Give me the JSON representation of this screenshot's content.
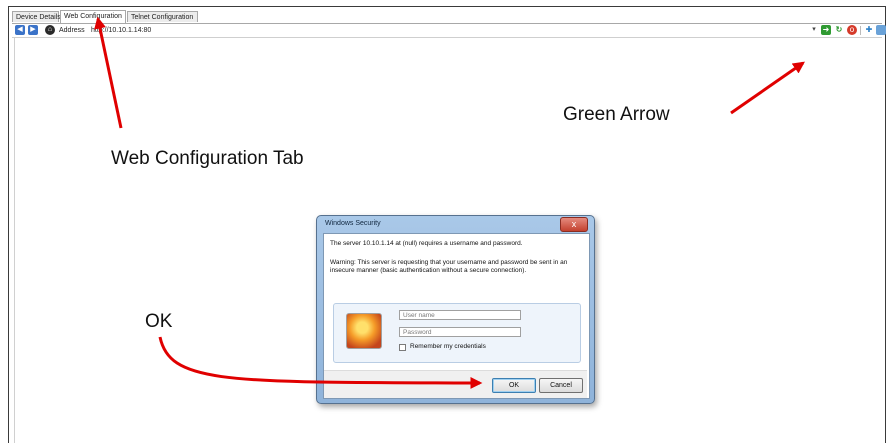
{
  "tabs": [
    {
      "label": "Device Details",
      "active": false
    },
    {
      "label": "Web Configuration",
      "active": true
    },
    {
      "label": "Telnet Configuration",
      "active": false
    }
  ],
  "toolbar": {
    "address_label": "Address",
    "address_value": "http://10.10.1.14:80",
    "icons": [
      "back-icon",
      "forward-icon",
      "home-icon",
      "dropdown-icon",
      "green-arrow-icon",
      "refresh-icon",
      "stop-icon",
      "favorites-icon",
      "screen-icon"
    ]
  },
  "annotations": {
    "web_config": "Web Configuration Tab",
    "green_arrow": "Green Arrow",
    "ok": "OK"
  },
  "dialog": {
    "title": "Windows Security",
    "close_glyph": "x",
    "message": "The server 10.10.1.14 at (null) requires a username and password.",
    "warning": "Warning: This server is requesting that your username and password be sent in an insecure manner (basic authentication without a secure connection).",
    "username_placeholder": "User name",
    "password_placeholder": "Password",
    "remember_label": "Remember my credentials",
    "ok_label": "OK",
    "cancel_label": "Cancel"
  },
  "colors": {
    "annotation_arrow": "#e00000",
    "nav_blue": "#3b73c8",
    "dialog_frame": "#a9c8e8"
  }
}
